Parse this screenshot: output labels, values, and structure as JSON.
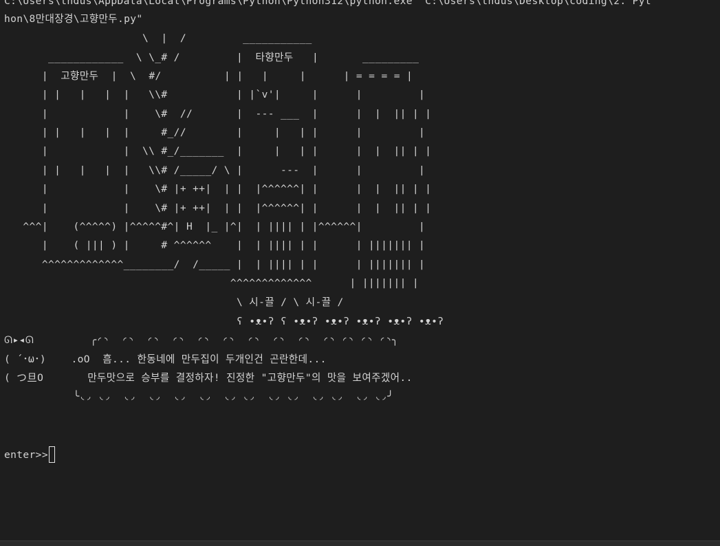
{
  "terminal": {
    "lines": [
      "C:\\Users\\thdus\\AppData\\Local\\Programs\\Python\\Python312\\python.exe \"C:\\Users\\thdus\\Desktop\\coding\\2. Pyt",
      "hon\\8만대장경\\고향만두.py\"",
      "                      \\  |  /         ___________",
      "       ____________  \\ \\_# /         |  타향만두   |       _________",
      "      |  고향만두  |  \\  #/          | |   |     |      | = = = = |",
      "      | |   |   |  |   \\\\#           | |`v'|     |      |         |",
      "      |            |    \\#  //       |  --- ___  |      |  |  || | |",
      "      | |   |   |  |     #_//        |     |   | |      |         |",
      "      |            |  \\\\ #_/_______  |     |   | |      |  |  || | |",
      "      | |   |   |  |   \\\\# /_____/ \\ |      ---  |      |         |",
      "      |            |    \\# |+ ++|  | |  |^^^^^^| |      |  |  || | |",
      "      |            |    \\# |+ ++|  | |  |^^^^^^| |      |  |  || | |",
      "   ^^^|    (^^^^^) |^^^^^#^| H  |_ |^|  | |||| | |^^^^^^|         |",
      "      |    ( ||| ) |     # ^^^^^^    |  | |||| | |      | ||||||| |",
      "      ^^^^^^^^^^^^^________/  /_____ |  | |||| | |      | ||||||| |",
      "                                    ^^^^^^^^^^^^^      | ||||||| |",
      "                                     \\ 시-끌 / \\ 시-끌 /",
      "                                     ʕ •ᴥ•ʔ ʕ •ᴥ•ʔ •ᴥ•ʔ •ᴥ•ʔ •ᴥ•ʔ •ᴥ•ʔ",
      "ᘏ▸◂ᘏ         ╭◜◝  ◜◝  ◜◝  ◜◝  ◜◝  ◜◝  ◜◝  ◜◝  ◜◝  ◜◝ ◜◝ ◜◝ ◜◝╮",
      "( ´･ω･)    .oO  흠... 한동네에 만두집이 두개인건 곤란한데...",
      "( つ旦O       만두맛으로 승부를 결정하자! 진정한 \"고향만두\"의 맛을 보여주겠어..",
      "           ╰◟◞ ◟◞  ◟◞  ◟◞  ◟◞  ◟◞  ◟◞ ◟◞  ◟◞ ◟◞  ◟◞ ◟◞  ◟◞ ◟◞╯"
    ],
    "prompt": "enter>>"
  }
}
